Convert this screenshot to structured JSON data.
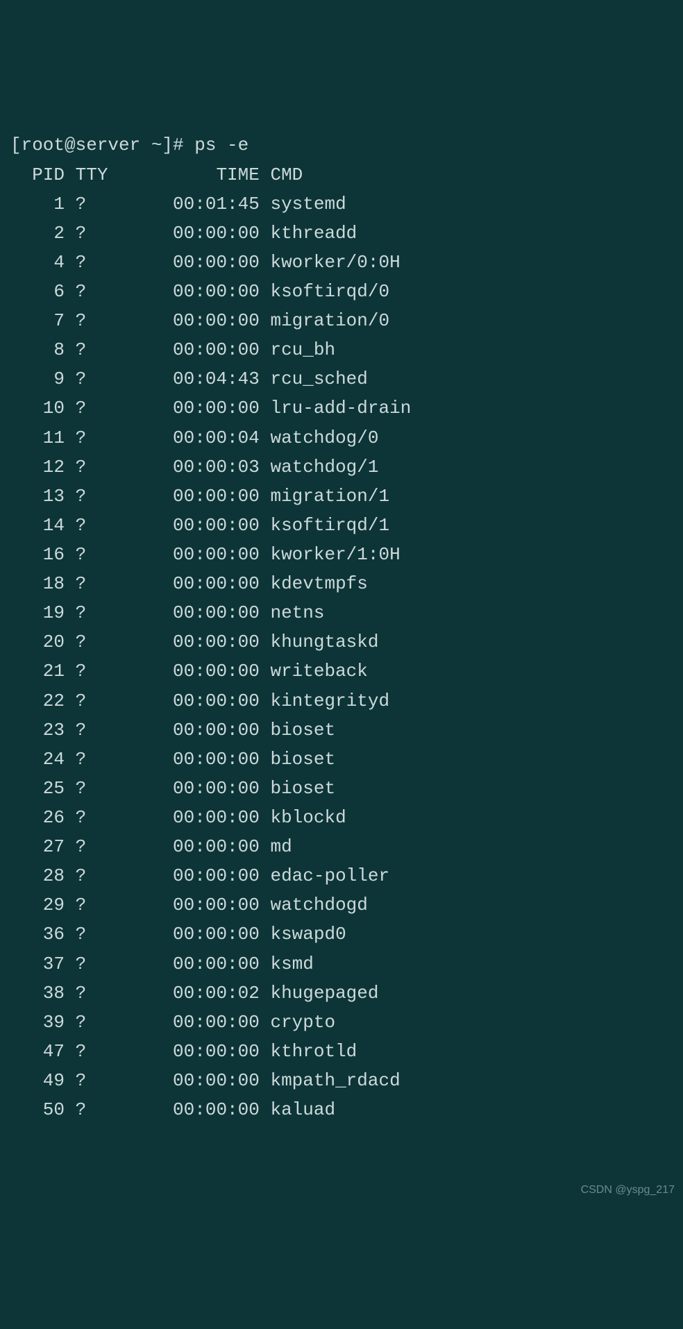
{
  "prompt": "[root@server ~]# ",
  "command": "ps -e",
  "headers": {
    "pid": "PID",
    "tty": "TTY",
    "time": "TIME",
    "cmd": "CMD"
  },
  "rows": [
    {
      "pid": "1",
      "tty": "?",
      "time": "00:01:45",
      "cmd": "systemd"
    },
    {
      "pid": "2",
      "tty": "?",
      "time": "00:00:00",
      "cmd": "kthreadd"
    },
    {
      "pid": "4",
      "tty": "?",
      "time": "00:00:00",
      "cmd": "kworker/0:0H"
    },
    {
      "pid": "6",
      "tty": "?",
      "time": "00:00:00",
      "cmd": "ksoftirqd/0"
    },
    {
      "pid": "7",
      "tty": "?",
      "time": "00:00:00",
      "cmd": "migration/0"
    },
    {
      "pid": "8",
      "tty": "?",
      "time": "00:00:00",
      "cmd": "rcu_bh"
    },
    {
      "pid": "9",
      "tty": "?",
      "time": "00:04:43",
      "cmd": "rcu_sched"
    },
    {
      "pid": "10",
      "tty": "?",
      "time": "00:00:00",
      "cmd": "lru-add-drain"
    },
    {
      "pid": "11",
      "tty": "?",
      "time": "00:00:04",
      "cmd": "watchdog/0"
    },
    {
      "pid": "12",
      "tty": "?",
      "time": "00:00:03",
      "cmd": "watchdog/1"
    },
    {
      "pid": "13",
      "tty": "?",
      "time": "00:00:00",
      "cmd": "migration/1"
    },
    {
      "pid": "14",
      "tty": "?",
      "time": "00:00:00",
      "cmd": "ksoftirqd/1"
    },
    {
      "pid": "16",
      "tty": "?",
      "time": "00:00:00",
      "cmd": "kworker/1:0H"
    },
    {
      "pid": "18",
      "tty": "?",
      "time": "00:00:00",
      "cmd": "kdevtmpfs"
    },
    {
      "pid": "19",
      "tty": "?",
      "time": "00:00:00",
      "cmd": "netns"
    },
    {
      "pid": "20",
      "tty": "?",
      "time": "00:00:00",
      "cmd": "khungtaskd"
    },
    {
      "pid": "21",
      "tty": "?",
      "time": "00:00:00",
      "cmd": "writeback"
    },
    {
      "pid": "22",
      "tty": "?",
      "time": "00:00:00",
      "cmd": "kintegrityd"
    },
    {
      "pid": "23",
      "tty": "?",
      "time": "00:00:00",
      "cmd": "bioset"
    },
    {
      "pid": "24",
      "tty": "?",
      "time": "00:00:00",
      "cmd": "bioset"
    },
    {
      "pid": "25",
      "tty": "?",
      "time": "00:00:00",
      "cmd": "bioset"
    },
    {
      "pid": "26",
      "tty": "?",
      "time": "00:00:00",
      "cmd": "kblockd"
    },
    {
      "pid": "27",
      "tty": "?",
      "time": "00:00:00",
      "cmd": "md"
    },
    {
      "pid": "28",
      "tty": "?",
      "time": "00:00:00",
      "cmd": "edac-poller"
    },
    {
      "pid": "29",
      "tty": "?",
      "time": "00:00:00",
      "cmd": "watchdogd"
    },
    {
      "pid": "36",
      "tty": "?",
      "time": "00:00:00",
      "cmd": "kswapd0"
    },
    {
      "pid": "37",
      "tty": "?",
      "time": "00:00:00",
      "cmd": "ksmd"
    },
    {
      "pid": "38",
      "tty": "?",
      "time": "00:00:02",
      "cmd": "khugepaged"
    },
    {
      "pid": "39",
      "tty": "?",
      "time": "00:00:00",
      "cmd": "crypto"
    },
    {
      "pid": "47",
      "tty": "?",
      "time": "00:00:00",
      "cmd": "kthrotld"
    },
    {
      "pid": "49",
      "tty": "?",
      "time": "00:00:00",
      "cmd": "kmpath_rdacd"
    },
    {
      "pid": "50",
      "tty": "?",
      "time": "00:00:00",
      "cmd": "kaluad"
    }
  ],
  "watermark": "CSDN @yspg_217"
}
